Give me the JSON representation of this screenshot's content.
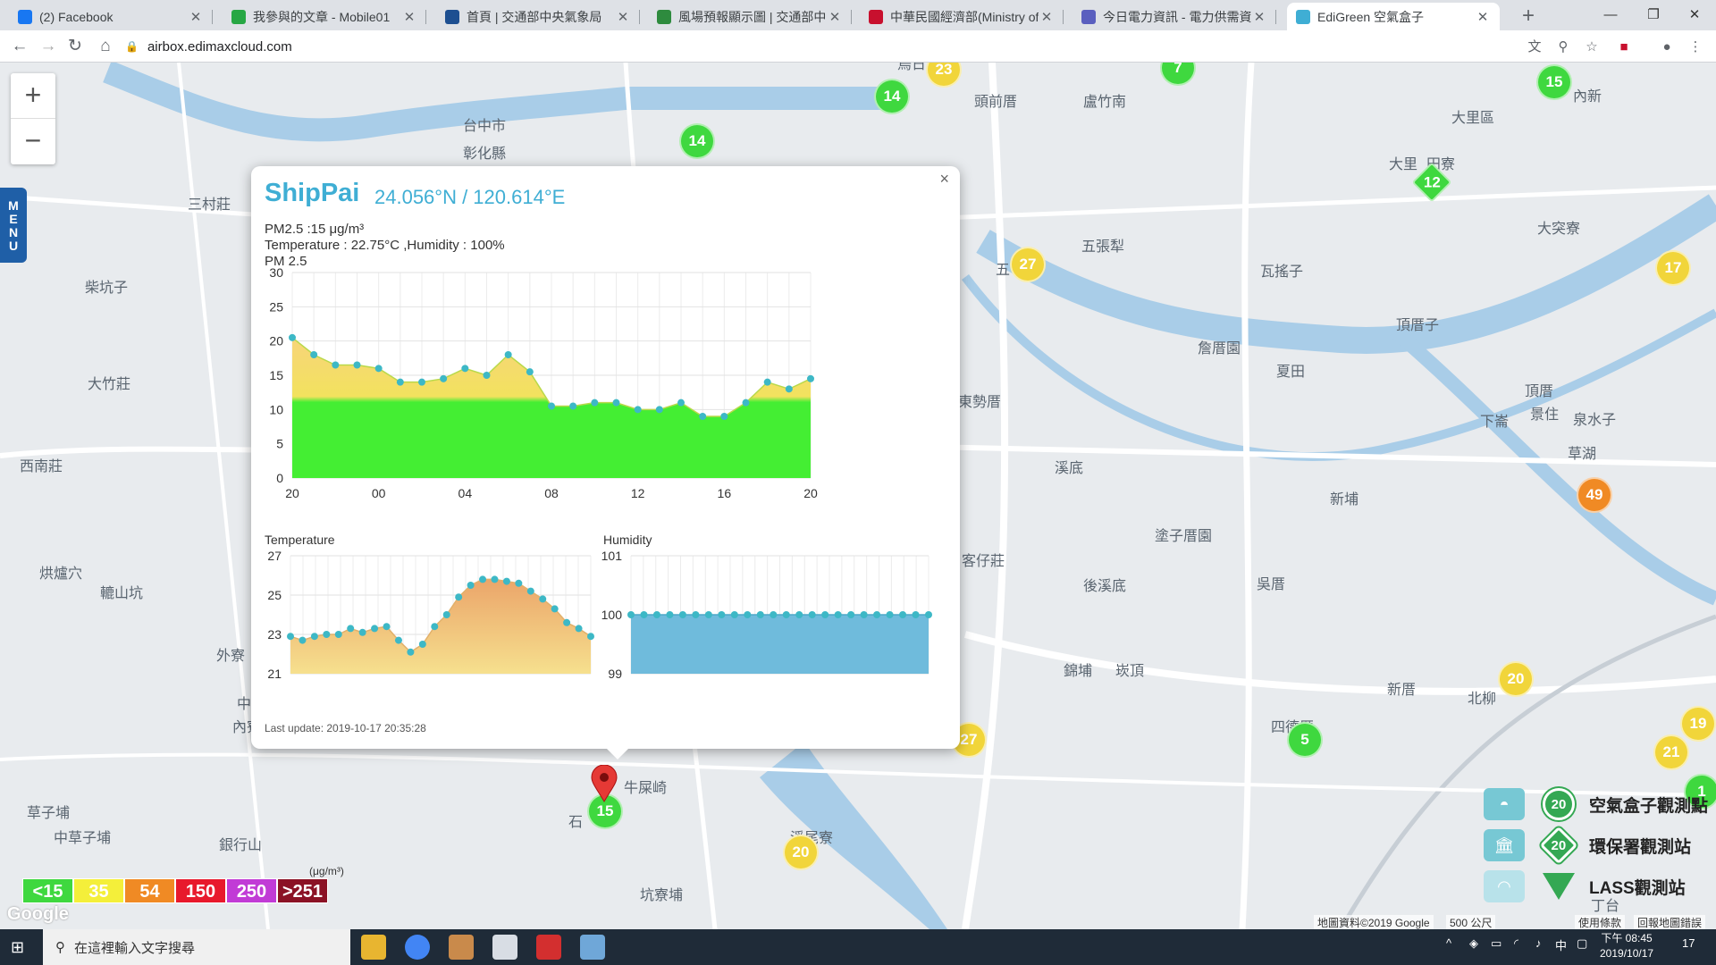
{
  "browser": {
    "tabs": [
      {
        "title": "(2) Facebook",
        "color": "#1877f2"
      },
      {
        "title": "我參與的文章 - Mobile01",
        "color": "#27a744"
      },
      {
        "title": "首頁 | 交通部中央氣象局",
        "color": "#1d4f91"
      },
      {
        "title": "風場預報顯示圖 | 交通部中央氣象...",
        "color": "#2e8b3e"
      },
      {
        "title": "中華民國經濟部(Ministry of Eco...",
        "color": "#c8102e"
      },
      {
        "title": "今日電力資訊 - 電力供需資訊 - 台...",
        "color": "#5a5fbf"
      },
      {
        "title": "EdiGreen 空氣盒子",
        "color": "#3faed4"
      }
    ],
    "url": "airbox.edimaxcloud.com"
  },
  "map": {
    "zoom_in": "+",
    "zoom_out": "−",
    "menu": "MENU",
    "places": [
      "烏日",
      "頭前厝",
      "盧竹南",
      "內新",
      "大里區",
      "大里",
      "田寮",
      "三村莊",
      "柴坑子",
      "大竹莊",
      "西南莊",
      "五張犁",
      "瓦搖子",
      "大突寮",
      "頂厝子",
      "詹厝園",
      "夏田",
      "東勢厝",
      "溪底",
      "新埔",
      "草湖",
      "頂厝",
      "下崙",
      "泉水子",
      "景住",
      "客仔莊",
      "塗子厝園",
      "烘爐穴",
      "轆山坑",
      "外寮",
      "內寮",
      "後溪底",
      "吳厝",
      "錦埔",
      "崁頂",
      "四德厝",
      "新厝",
      "北柳",
      "草子埔",
      "中草子埔",
      "銀行山",
      "牛屎崎",
      "石",
      "溪尾寮",
      "坑寮埔",
      "丁台",
      "台中市",
      "彰化縣",
      "五",
      "中"
    ],
    "markers": [
      {
        "value": "23",
        "c": "y"
      },
      {
        "value": "14",
        "c": "g"
      },
      {
        "value": "14",
        "c": "g"
      },
      {
        "value": "7",
        "c": "g"
      },
      {
        "value": "15",
        "c": "g"
      },
      {
        "value": "12",
        "c": "g"
      },
      {
        "value": "27",
        "c": "y"
      },
      {
        "value": "17",
        "c": "y"
      },
      {
        "value": "49",
        "c": "o"
      },
      {
        "value": "20",
        "c": "y"
      },
      {
        "value": "27",
        "c": "y"
      },
      {
        "value": "5",
        "c": "g"
      },
      {
        "value": "19",
        "c": "y"
      },
      {
        "value": "21",
        "c": "y"
      },
      {
        "value": "20",
        "c": "y"
      },
      {
        "value": "15",
        "c": "g"
      },
      {
        "value": "1",
        "c": "g"
      }
    ],
    "legend": [
      {
        "label": "<15",
        "color": "#3fd83f"
      },
      {
        "label": "35",
        "color": "#f4ef3a"
      },
      {
        "label": "54",
        "color": "#f08a24"
      },
      {
        "label": "150",
        "color": "#e8192c"
      },
      {
        "label": "250",
        "color": "#c13bd6"
      },
      {
        "label": ">251",
        "color": "#8b1225"
      }
    ],
    "legend_unit": "(μg/m³)",
    "google": "Google",
    "station_legend": [
      {
        "value": "20",
        "label": "空氣盒子觀測點"
      },
      {
        "value": "20",
        "label": "環保署觀測站"
      },
      {
        "value": "20",
        "label": "LASS觀測站"
      }
    ],
    "attribution": "地圖資料©2019 Google",
    "scale": "500 公尺",
    "terms": "使用條款",
    "report": "回報地圖錯誤"
  },
  "popup": {
    "title": "ShipPai",
    "coord": "24.056°N / 120.614°E",
    "pm_line": "PM2.5 :15 μg/m³",
    "env_line": "Temperature : 22.75°C ,Humidity : 100%",
    "pm_chart_label": "PM 2.5",
    "temp_label": "Temperature",
    "hum_label": "Humidity",
    "last_update": "Last update: 2019-10-17 20:35:28",
    "close": "×"
  },
  "chart_data": [
    {
      "type": "area",
      "title": "PM 2.5",
      "x": [
        "20",
        "",
        "",
        "",
        "00",
        "",
        "",
        "",
        "04",
        "",
        "",
        "",
        "08",
        "",
        "",
        "",
        "12",
        "",
        "",
        "",
        "16",
        "",
        "",
        "",
        "20"
      ],
      "xticks": [
        "20",
        "00",
        "04",
        "08",
        "12",
        "16",
        "20"
      ],
      "yticks": [
        0,
        5,
        10,
        15,
        20,
        25,
        30
      ],
      "ylim": [
        0,
        30
      ],
      "values": [
        20.5,
        18,
        16.5,
        16.5,
        16,
        14,
        14,
        14.5,
        16,
        15,
        18,
        15.5,
        10.5,
        10.5,
        11,
        11,
        10,
        10,
        11,
        9,
        9,
        11,
        14,
        13,
        14.5
      ],
      "grid": true
    },
    {
      "type": "area",
      "title": "Temperature",
      "yticks": [
        21,
        23,
        25,
        27
      ],
      "ylim": [
        21,
        27
      ],
      "values": [
        22.9,
        22.7,
        22.9,
        23,
        23,
        23.3,
        23.1,
        23.3,
        23.4,
        22.7,
        22.1,
        22.5,
        23.4,
        24,
        24.9,
        25.5,
        25.8,
        25.8,
        25.7,
        25.6,
        25.2,
        24.8,
        24.3,
        23.6,
        23.3,
        22.9
      ],
      "grid": true
    },
    {
      "type": "area",
      "title": "Humidity",
      "yticks": [
        99,
        100,
        101
      ],
      "ylim": [
        99,
        101
      ],
      "values": [
        100,
        100,
        100,
        100,
        100,
        100,
        100,
        100,
        100,
        100,
        100,
        100,
        100,
        100,
        100,
        100,
        100,
        100,
        100,
        100,
        100,
        100,
        100,
        100
      ],
      "grid": true
    }
  ],
  "taskbar": {
    "search_placeholder": "在這裡輸入文字搜尋",
    "time": "下午 08:45",
    "date": "2019/10/17",
    "ime": "中",
    "notify": "17"
  }
}
